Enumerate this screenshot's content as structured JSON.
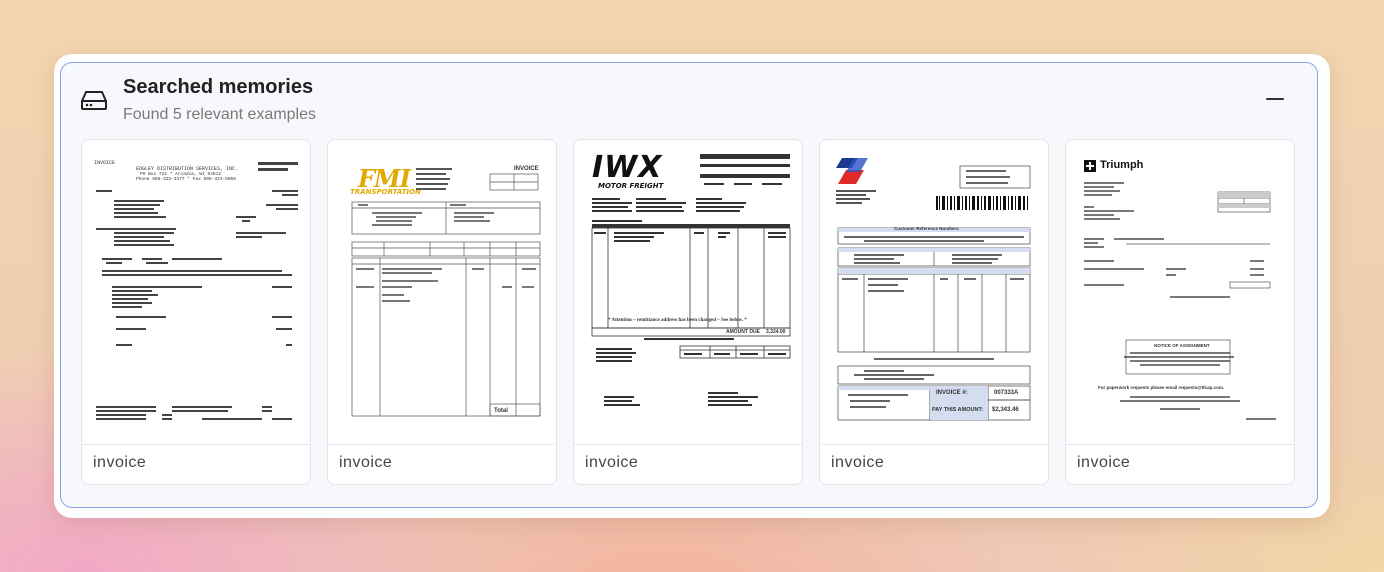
{
  "panel": {
    "title": "Searched memories",
    "subtitle": "Found 5 relevant examples",
    "icons": {
      "storage": "hard-drive-icon",
      "collapse": "minus-icon"
    },
    "accent_color": "#8da0ee"
  },
  "cards": [
    {
      "label": "invoice",
      "doc": {
        "heading": "INVOICE",
        "company": "EDGLEY DISTRIBUTION SERVICES, INC.",
        "lines": [
          "PO Box 722 * Arcadia, WI 54612",
          "Phone 608-323-3377 * Fax 608-323-6066"
        ]
      }
    },
    {
      "label": "invoice",
      "doc": {
        "logo_top": "FMI",
        "logo_bottom": "TRANSPORTATION",
        "heading": "INVOICE",
        "total_label": "Total"
      }
    },
    {
      "label": "invoice",
      "doc": {
        "logo_top": "IWX",
        "logo_bottom": "MOTOR FREIGHT",
        "notice": "* Attention – remittance address has been changed – See below. *",
        "amount_label": "AMOUNT DUE",
        "amount_value": "3,324.00"
      }
    },
    {
      "label": "invoice",
      "doc": {
        "heading": "Customer Reference Numbers",
        "invoice_no_label": "INVOICE #:",
        "invoice_no": "007333A",
        "pay_label": "PAY THIS AMOUNT:",
        "pay_value": "$2,343.46"
      }
    },
    {
      "label": "invoice",
      "doc": {
        "logo": "Triumph",
        "notice_title": "NOTICE OF ASSIGNMENT",
        "footer": "For paperwork requests please email requests@tfcap.com."
      }
    }
  ]
}
